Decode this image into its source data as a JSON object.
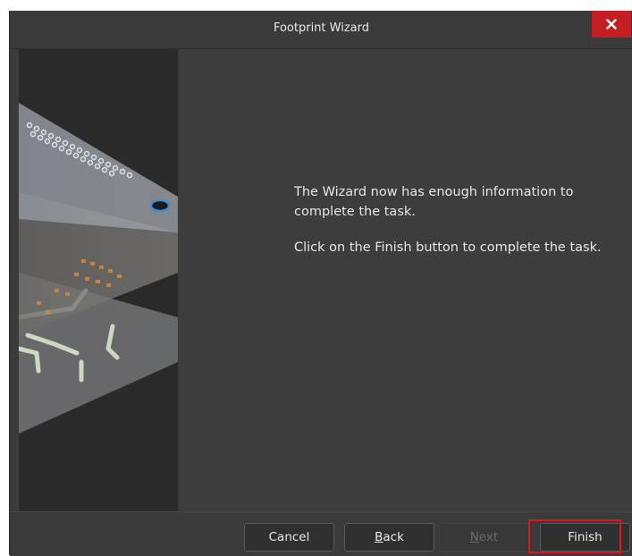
{
  "window": {
    "title": "Footprint Wizard",
    "close_icon": "close-icon"
  },
  "content": {
    "message_1": "The Wizard now has enough information to complete the task.",
    "message_2": "Click on the Finish button to complete the task."
  },
  "illustration": {
    "icon": "pcb-layers-illustration"
  },
  "buttons": {
    "cancel": {
      "label": "Cancel",
      "enabled": true
    },
    "back": {
      "label_mnemonic": "B",
      "label_rest": "ack",
      "enabled": true
    },
    "next": {
      "label_mnemonic": "N",
      "label_rest": "ext",
      "enabled": false
    },
    "finish": {
      "label": "Finish",
      "enabled": true,
      "highlighted": true
    }
  },
  "colors": {
    "dialog_bg": "#3b3b3b",
    "close_bg": "#c41e22",
    "highlight": "#e0141a"
  }
}
